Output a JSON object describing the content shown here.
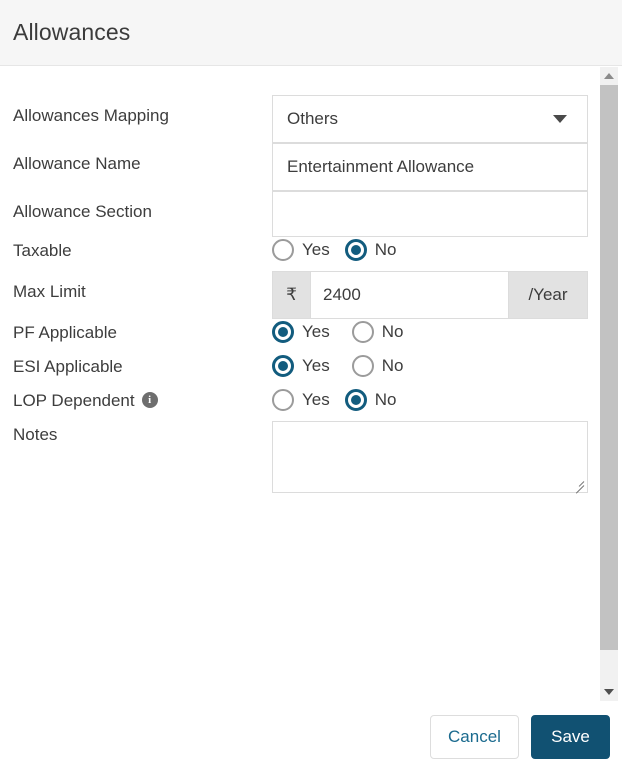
{
  "header": {
    "title": "Allowances"
  },
  "form": {
    "mapping": {
      "label": "Allowances Mapping",
      "value": "Others",
      "caret_icon": "chevron-down-icon"
    },
    "allowance_name": {
      "label": "Allowance Name",
      "value": "Entertainment Allowance",
      "placeholder": ""
    },
    "allowance_section": {
      "label": "Allowance Section",
      "value": "",
      "placeholder": ""
    },
    "taxable": {
      "label": "Taxable",
      "yes_label": "Yes",
      "no_label": "No",
      "selected": "No"
    },
    "max_limit": {
      "label": "Max Limit",
      "currency_symbol": "₹",
      "value": "2400",
      "period": "/Year"
    },
    "pf_applicable": {
      "label": "PF Applicable",
      "yes_label": "Yes",
      "no_label": "No",
      "selected": "Yes"
    },
    "esi_applicable": {
      "label": "ESI Applicable",
      "yes_label": "Yes",
      "no_label": "No",
      "selected": "Yes"
    },
    "lop_dependent": {
      "label": "LOP Dependent",
      "info_icon": "info-icon",
      "info_glyph": "i",
      "yes_label": "Yes",
      "no_label": "No",
      "selected": "No"
    },
    "notes": {
      "label": "Notes",
      "value": "",
      "placeholder": ""
    }
  },
  "footer": {
    "cancel_label": "Cancel",
    "save_label": "Save"
  },
  "scrollbar": {
    "up_icon": "scroll-up-arrow-icon",
    "down_icon": "scroll-down-arrow-icon"
  },
  "colors": {
    "accent": "#115172",
    "radio_selected": "#125c7e",
    "link_text": "#1a6a8e",
    "header_bg": "#f6f6f6",
    "addon_bg": "#e2e2e2",
    "border": "#dcdcdc"
  }
}
